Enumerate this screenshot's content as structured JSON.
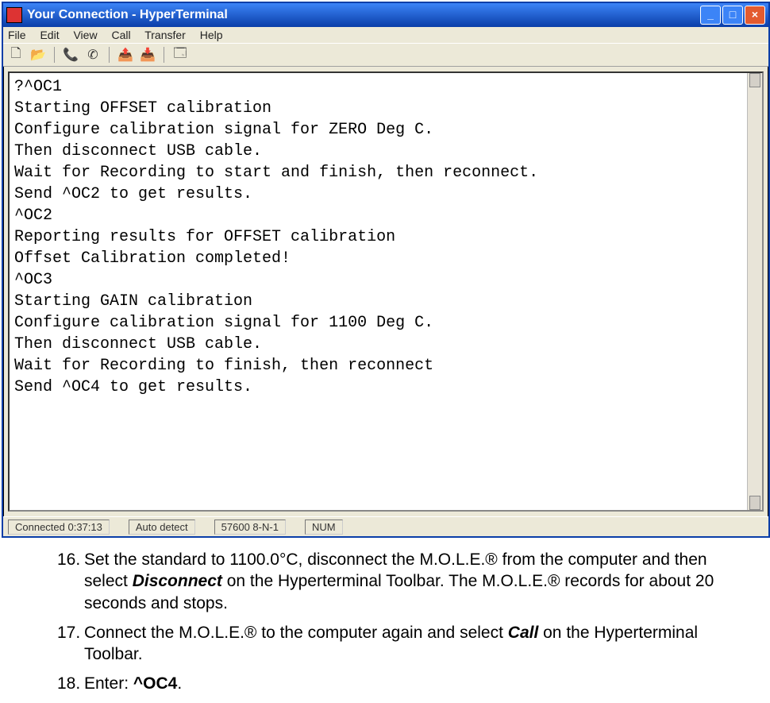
{
  "window": {
    "title": "Your Connection - HyperTerminal"
  },
  "menus": {
    "file": "File",
    "edit": "Edit",
    "view": "View",
    "call": "Call",
    "transfer": "Transfer",
    "help": "Help"
  },
  "terminal": {
    "lines": [
      "?^OC1",
      "Starting OFFSET calibration",
      "Configure calibration signal for ZERO Deg C.",
      "Then disconnect USB cable.",
      "Wait for Recording to start and finish, then reconnect.",
      "Send ^OC2 to get results.",
      "^OC2",
      "Reporting results for OFFSET calibration",
      "Offset Calibration completed!",
      "^OC3",
      "Starting GAIN calibration",
      "Configure calibration signal for 1100 Deg C.",
      "Then disconnect USB cable.",
      "Wait for Recording to finish, then reconnect",
      "Send ^OC4 to get results."
    ]
  },
  "status": {
    "connected": "Connected 0:37:13",
    "auto": "Auto detect",
    "rate": "57600 8-N-1",
    "num": "NUM"
  },
  "instructions": {
    "item16_num": "16.",
    "item16_a": "Set the standard to 1100.0°C, disconnect the M.O.L.E.® from the computer and then select ",
    "item16_b": "Disconnect",
    "item16_c": " on the Hyperterminal Toolbar. The M.O.L.E.® records for about 20 seconds and stops.",
    "item17_num": "17.",
    "item17_a": "Connect the M.O.L.E.® to the computer again and select ",
    "item17_b": "Call",
    "item17_c": " on the Hyperterminal Toolbar.",
    "item18_num": "18.",
    "item18_a": "Enter: ",
    "item18_b": "^OC4",
    "item18_c": "."
  }
}
